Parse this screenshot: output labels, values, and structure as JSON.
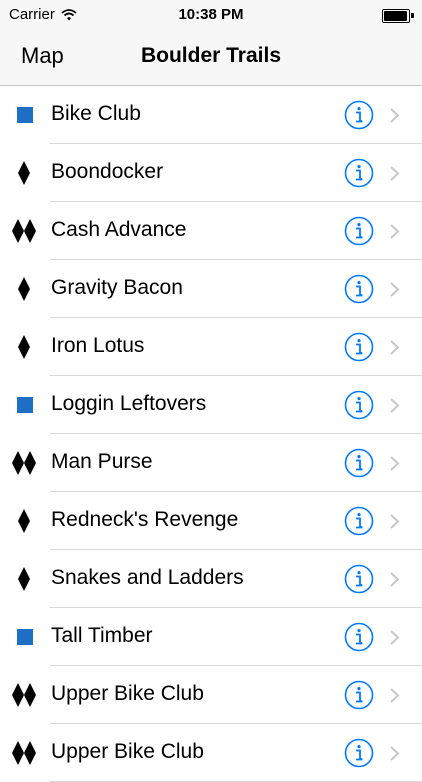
{
  "status_bar": {
    "carrier": "Carrier",
    "time": "10:38 PM",
    "battery_level": 0.95
  },
  "nav": {
    "back_label": "Map",
    "title": "Boulder Trails"
  },
  "colors": {
    "accent": "#007aff",
    "blue_square": "#1f6fc4",
    "chevron": "#c7c7cc"
  },
  "trails": [
    {
      "name": "Bike Club",
      "difficulty": "blue-square-icon"
    },
    {
      "name": "Boondocker",
      "difficulty": "black-diamond-icon"
    },
    {
      "name": "Cash Advance",
      "difficulty": "double-black-diamond-icon"
    },
    {
      "name": "Gravity Bacon",
      "difficulty": "black-diamond-icon"
    },
    {
      "name": "Iron Lotus",
      "difficulty": "black-diamond-icon"
    },
    {
      "name": "Loggin Leftovers",
      "difficulty": "blue-square-icon"
    },
    {
      "name": "Man Purse",
      "difficulty": "double-black-diamond-icon"
    },
    {
      "name": "Redneck's Revenge",
      "difficulty": "black-diamond-icon"
    },
    {
      "name": "Snakes and Ladders",
      "difficulty": "black-diamond-icon"
    },
    {
      "name": "Tall Timber",
      "difficulty": "blue-square-icon"
    },
    {
      "name": "Upper Bike Club",
      "difficulty": "double-black-diamond-icon"
    },
    {
      "name": "Upper Bike Club",
      "difficulty": "double-black-diamond-icon"
    }
  ]
}
